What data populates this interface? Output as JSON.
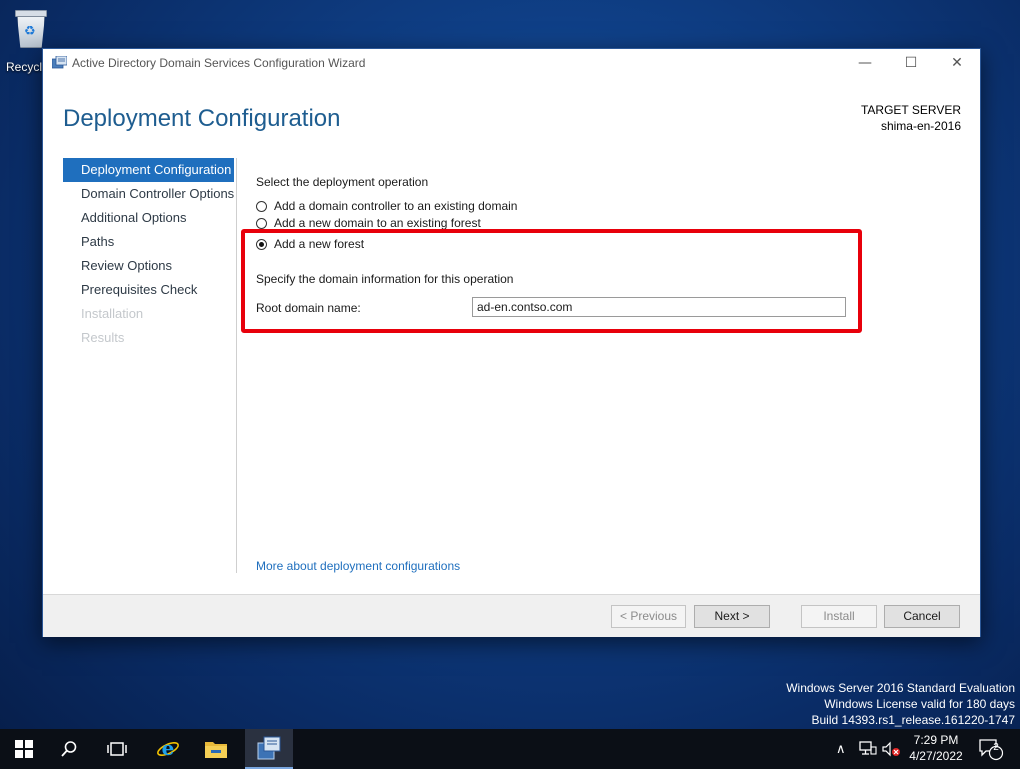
{
  "desktop": {
    "recycle_bin_label": "Recycle Bin"
  },
  "window": {
    "title": "Active Directory Domain Services Configuration Wizard",
    "controls": {
      "minimize": "—",
      "maximize": "☐",
      "close": "✕"
    }
  },
  "header": {
    "page_title": "Deployment Configuration",
    "target_label": "TARGET SERVER",
    "target_value": "shima-en-2016"
  },
  "nav": {
    "items": [
      {
        "label": "Deployment Configuration",
        "state": "active"
      },
      {
        "label": "Domain Controller Options",
        "state": "normal"
      },
      {
        "label": "Additional Options",
        "state": "normal"
      },
      {
        "label": "Paths",
        "state": "normal"
      },
      {
        "label": "Review Options",
        "state": "normal"
      },
      {
        "label": "Prerequisites Check",
        "state": "normal"
      },
      {
        "label": "Installation",
        "state": "disabled"
      },
      {
        "label": "Results",
        "state": "disabled"
      }
    ]
  },
  "main": {
    "operation_label": "Select the deployment operation",
    "options": [
      {
        "label": "Add a domain controller to an existing domain",
        "checked": false
      },
      {
        "label": "Add a new domain to an existing forest",
        "checked": false
      },
      {
        "label": "Add a new forest",
        "checked": true
      }
    ],
    "domain_info_label": "Specify the domain information for this operation",
    "root_domain_label": "Root domain name:",
    "root_domain_value": "ad-en.contso.com",
    "more_link": "More about deployment configurations"
  },
  "footer": {
    "previous": "< Previous",
    "next": "Next >",
    "install": "Install",
    "cancel": "Cancel"
  },
  "watermark": {
    "line1": "Windows Server 2016 Standard Evaluation",
    "line2": "Windows License valid for 180 days",
    "line3": "Build 14393.rs1_release.161220-1747"
  },
  "taskbar": {
    "time": "7:29 PM",
    "date": "4/27/2022",
    "notification_count": "2"
  },
  "colors": {
    "accent": "#1f6fbe",
    "title": "#1e5d90",
    "highlight": "#e8000b"
  }
}
